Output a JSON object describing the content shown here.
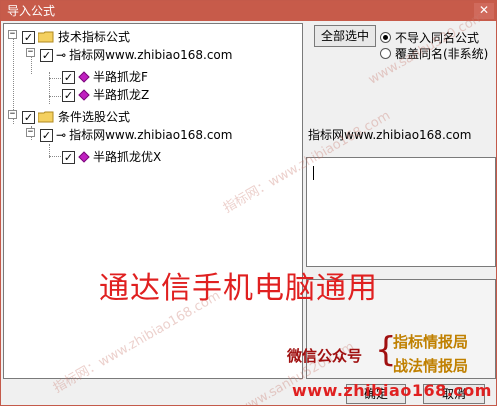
{
  "window": {
    "title": "导入公式",
    "close_glyph": "✕"
  },
  "tree": {
    "groups": [
      {
        "label": "技术指标公式",
        "checked": true,
        "source": {
          "label": "指标网www.zhibiao168.com",
          "checked": true
        },
        "items": [
          {
            "label": "半路抓龙F",
            "checked": true
          },
          {
            "label": "半路抓龙Z",
            "checked": true
          }
        ]
      },
      {
        "label": "条件选股公式",
        "checked": true,
        "source": {
          "label": "指标网www.zhibiao168.com",
          "checked": true
        },
        "items": [
          {
            "label": "半路抓龙优X",
            "checked": true
          }
        ]
      }
    ]
  },
  "options": {
    "select_all_label": "全部选中",
    "radio_no_import_label": "不导入同名公式",
    "radio_overwrite_label": "覆盖同名(非系统)",
    "selected": "radio_no_import"
  },
  "detail": {
    "source_text": "指标网www.zhibiao168.com"
  },
  "footer": {
    "ok_label": "确定",
    "cancel_label": "取消"
  },
  "overlay": {
    "headline": "通达信手机电脑通用",
    "wechat_label": "微信公众号",
    "wechat_brace": "{",
    "wechat_account_1": "指标情报局",
    "wechat_account_2": "战法情报局",
    "website": "www.zhibiao168.com",
    "watermark_text": "指标网：www.zhibiao168.com",
    "watermark_text_2": "www.sanhu520.com"
  },
  "colors": {
    "title_bar": "#c75b4a",
    "headline": "#e02020",
    "account": "#c08000",
    "wechat": "#a01010"
  }
}
